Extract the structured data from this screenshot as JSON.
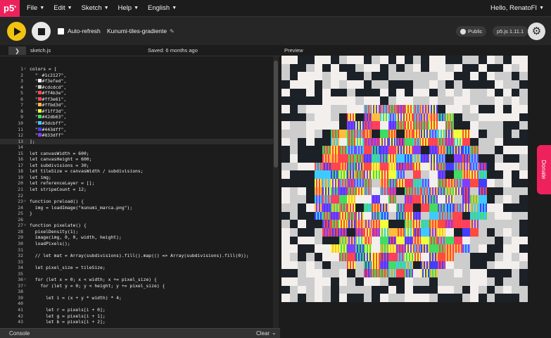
{
  "nav": {
    "logo": "p5",
    "logo_mark": "*",
    "menu": [
      "File",
      "Edit",
      "Sketch",
      "Help",
      "English"
    ],
    "greeting": "Hello, RenatoFI"
  },
  "toolbar": {
    "auto_refresh_label": "Auto-refresh",
    "sketch_name": "Kunumi-tiles-gradiente",
    "visibility_label": "Public",
    "version_label": "p5.js 1.11.1"
  },
  "editor": {
    "tab_name": "sketch.js",
    "saved_note": "Saved: 6 months ago",
    "preview_label": "Preview",
    "lines": [
      "colors = [",
      "  \"#1c2127\",",
      "  \"#f3efed\",",
      "  \"#cdcdcd\",",
      "  \"#ff4b3e\",",
      "  \"#ff3e61\",",
      "  \"#ffbd3d\",",
      "  \"#f1ff3d\",",
      "  \"#42db63\",",
      "  \"#3dcbff\",",
      "  \"#443dff\",",
      "  \"#833dff\"",
      "];",
      "",
      "let canvasWidth = 600;",
      "let canvasHeight = 600;",
      "let subdivisions = 30;",
      "let tileSize = canvasWidth / subdivisions;",
      "let img;",
      "let referenceLayer = [];",
      "let stripeCount = 12;",
      "",
      "function preload() {",
      "  img = loadImage(\"kunumi_marca.png\");",
      "}",
      "",
      "function pixelate() {",
      "  pixelDensity(1);",
      "  image(img, 0, 0, width, height);",
      "  loadPixels();",
      "",
      "  // let mat = Array(subdivisions).fill().map(() => Array(subdivisions).fill(0));",
      "",
      "  let pixel_size = tileSize;",
      "",
      "  for (let x = 0; x < width; x += pixel_size) {",
      "    for (let y = 0; y < height; y += pixel_size) {",
      "",
      "      let i = (x + y * width) * 4;",
      "",
      "      let r = pixels[i + 0];",
      "      let g = pixels[i + 1];",
      "      let b = pixels[i + 2];"
    ],
    "color_swatches": [
      "#1c2127",
      "#f3efed",
      "#cdcdcd",
      "#ff4b3e",
      "#ff3e61",
      "#ffbd3d",
      "#f1ff3d",
      "#42db63",
      "#3dcbff",
      "#443dff",
      "#833dff"
    ]
  },
  "console": {
    "label": "Console",
    "clear_label": "Clear"
  },
  "donate_label": "Donate",
  "colors": {
    "accent": "#ed225d",
    "play": "#f1c40f",
    "background": "#1c1c1c"
  }
}
